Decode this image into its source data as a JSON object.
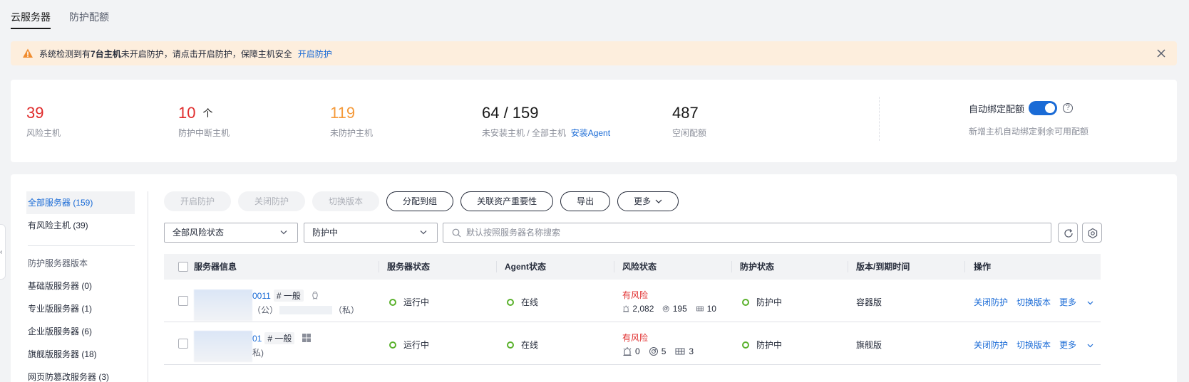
{
  "tabs": [
    {
      "label": "云服务器",
      "active": true
    },
    {
      "label": "防护配额",
      "active": false
    }
  ],
  "alert": {
    "text_pre": "系统检测到有",
    "text_bold": "7台主机",
    "text_post": "未开启防护，请点击开启防护，保障主机安全",
    "link": "开启防护",
    "accent": "#f59a3a"
  },
  "stats": {
    "risk": {
      "value": "39",
      "label": "风险主机"
    },
    "interrupted": {
      "value": "10",
      "unit": "个",
      "label": "防护中断主机"
    },
    "unprotected": {
      "value": "119",
      "label": "未防护主机"
    },
    "agent": {
      "value": "64 / 159",
      "label": "未安装主机  / 全部主机",
      "link": "安装Agent"
    },
    "idle": {
      "value": "487",
      "label": "空闲配额"
    },
    "autobind": {
      "label": "自动绑定配额",
      "enabled": true,
      "help": "?",
      "desc": "新增主机自动绑定剩余可用配额"
    }
  },
  "sidebar": {
    "items": [
      {
        "label": "全部服务器 (159)",
        "active": true
      },
      {
        "label": "有风险主机 (39)",
        "active": false
      }
    ],
    "section_title": "防护服务器版本",
    "versions": [
      {
        "label": "基础版服务器 (0)"
      },
      {
        "label": "专业版服务器 (1)"
      },
      {
        "label": "企业版服务器 (6)"
      },
      {
        "label": "旗舰版服务器 (18)"
      },
      {
        "label": "网页防篡改服务器 (3)"
      }
    ]
  },
  "toolbar": {
    "enable": "开启防护",
    "disable": "关闭防护",
    "switch_version": "切换版本",
    "assign_group": "分配到组",
    "link_importance": "关联资产重要性",
    "export": "导出",
    "more": "更多"
  },
  "filters": {
    "risk_status": "全部风险状态",
    "protect_status": "防护中",
    "search_placeholder": "默认按照服务器名称搜索"
  },
  "table": {
    "headers": {
      "server_info": "服务器信息",
      "server_status": "服务器状态",
      "agent_status": "Agent状态",
      "risk_status": "风险状态",
      "protect_status": "防护状态",
      "version": "版本/到期时间",
      "ops": "操作"
    },
    "rows": [
      {
        "name": "0011",
        "tag": "# 一般",
        "os_icon": "linux-icon",
        "ip_line_pre": "（公）",
        "ip_line_post": "（私）",
        "server_status": "运行中",
        "agent_status": "在线",
        "risk": "有风险",
        "risk_counts": [
          "2,082",
          "195",
          "10"
        ],
        "protect_status": "防护中",
        "version": "容器版",
        "ops": [
          "关闭防护",
          "切换版本",
          "更多"
        ]
      },
      {
        "name": "01",
        "tag": "# 一般",
        "os_icon": "windows-icon",
        "ip_line_pre": "",
        "ip_line_post": "私)",
        "server_status": "运行中",
        "agent_status": "在线",
        "risk": "有风险",
        "risk_counts": [
          "0",
          "5",
          "3"
        ],
        "protect_status": "防护中",
        "version": "旗舰版",
        "ops": [
          "关闭防护",
          "切换版本",
          "更多"
        ]
      }
    ]
  }
}
